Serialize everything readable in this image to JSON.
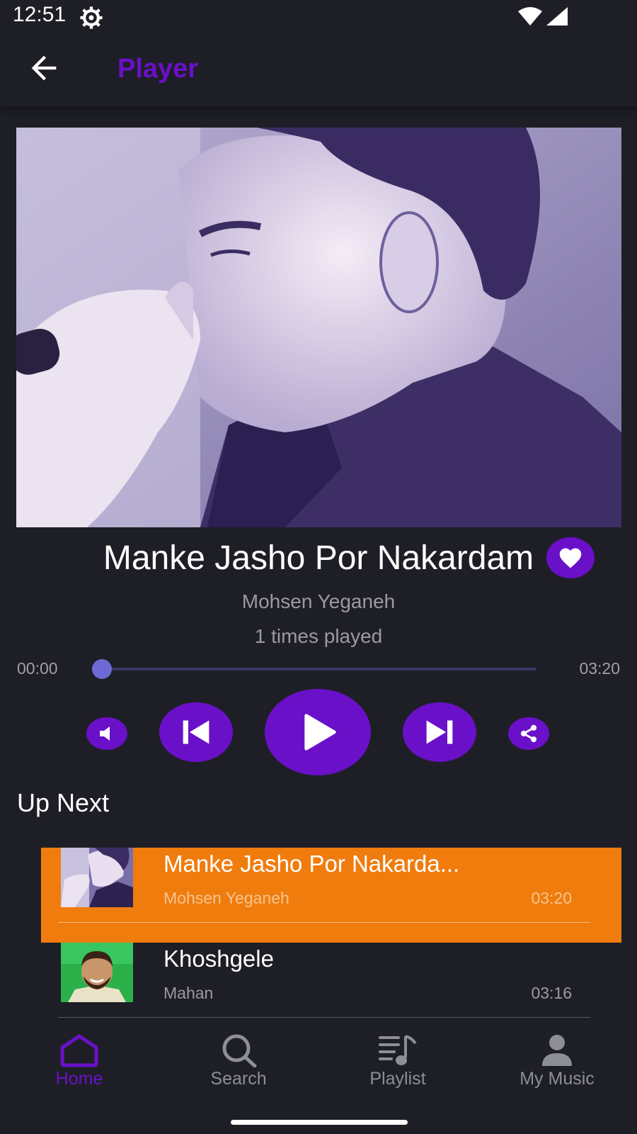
{
  "status_bar": {
    "time": "12:51"
  },
  "app_bar": {
    "title": "Player"
  },
  "now_playing": {
    "title": "Manke Jasho Por Nakardam",
    "artist": "Mohsen Yeganeh",
    "plays": "1 times played",
    "current_time": "00:00",
    "total_time": "03:20",
    "progress": 0.0
  },
  "controls": [
    "volume-icon",
    "previous-icon",
    "play-icon",
    "next-icon",
    "share-icon"
  ],
  "up_next": {
    "heading": "Up Next",
    "items": [
      {
        "title": "Manke Jasho Por Nakarda...",
        "artist": "Mohsen Yeganeh",
        "duration": "03:20",
        "active": true
      },
      {
        "title": "Khoshgele",
        "artist": "Mahan",
        "duration": "03:16",
        "active": false
      }
    ]
  },
  "bottom_nav": {
    "items": [
      {
        "label": "Home",
        "icon": "home-icon",
        "active": true
      },
      {
        "label": "Search",
        "icon": "search-icon",
        "active": false
      },
      {
        "label": "Playlist",
        "icon": "playlist-icon",
        "active": false
      },
      {
        "label": "My Music",
        "icon": "person-icon",
        "active": false
      }
    ]
  },
  "colors": {
    "accent": "#6a10c9",
    "background": "#1e1f26",
    "highlight": "#f07c0e"
  }
}
